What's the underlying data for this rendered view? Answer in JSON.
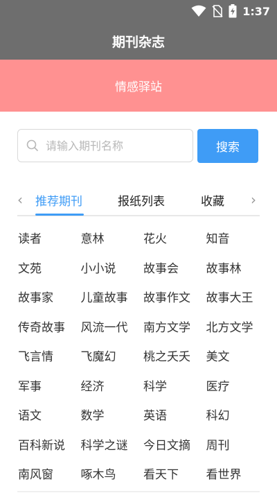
{
  "status": {
    "time": "1:37"
  },
  "appbar": {
    "title": "期刊杂志"
  },
  "banner": {
    "text": "情感驿站"
  },
  "search": {
    "placeholder": "请输入期刊名称",
    "value": "",
    "button_label": "搜索"
  },
  "tabs": {
    "items": [
      {
        "label": "推荐期刊",
        "active": true
      },
      {
        "label": "报纸列表",
        "active": false
      },
      {
        "label": "收藏",
        "active": false
      }
    ],
    "left_arrow": "‹",
    "right_arrow": "›"
  },
  "magazines": [
    "读者",
    "意林",
    "花火",
    "知音",
    "文苑",
    "小小说",
    "故事会",
    "故事林",
    "故事家",
    "儿童故事",
    "故事作文",
    "故事大王",
    "传奇故事",
    "风流一代",
    "南方文学",
    "北方文学",
    "飞言情",
    "飞魔幻",
    "桃之夭夭",
    "美文",
    "军事",
    "经济",
    "科学",
    "医疗",
    "语文",
    "数学",
    "英语",
    "科幻",
    "百科新说",
    "科学之谜",
    "今日文摘",
    "周刊",
    "南风窗",
    "啄木鸟",
    "看天下",
    "看世界"
  ],
  "colors": {
    "header": "#6e6e6e",
    "banner": "#ff9191",
    "accent": "#3f9cf6"
  }
}
